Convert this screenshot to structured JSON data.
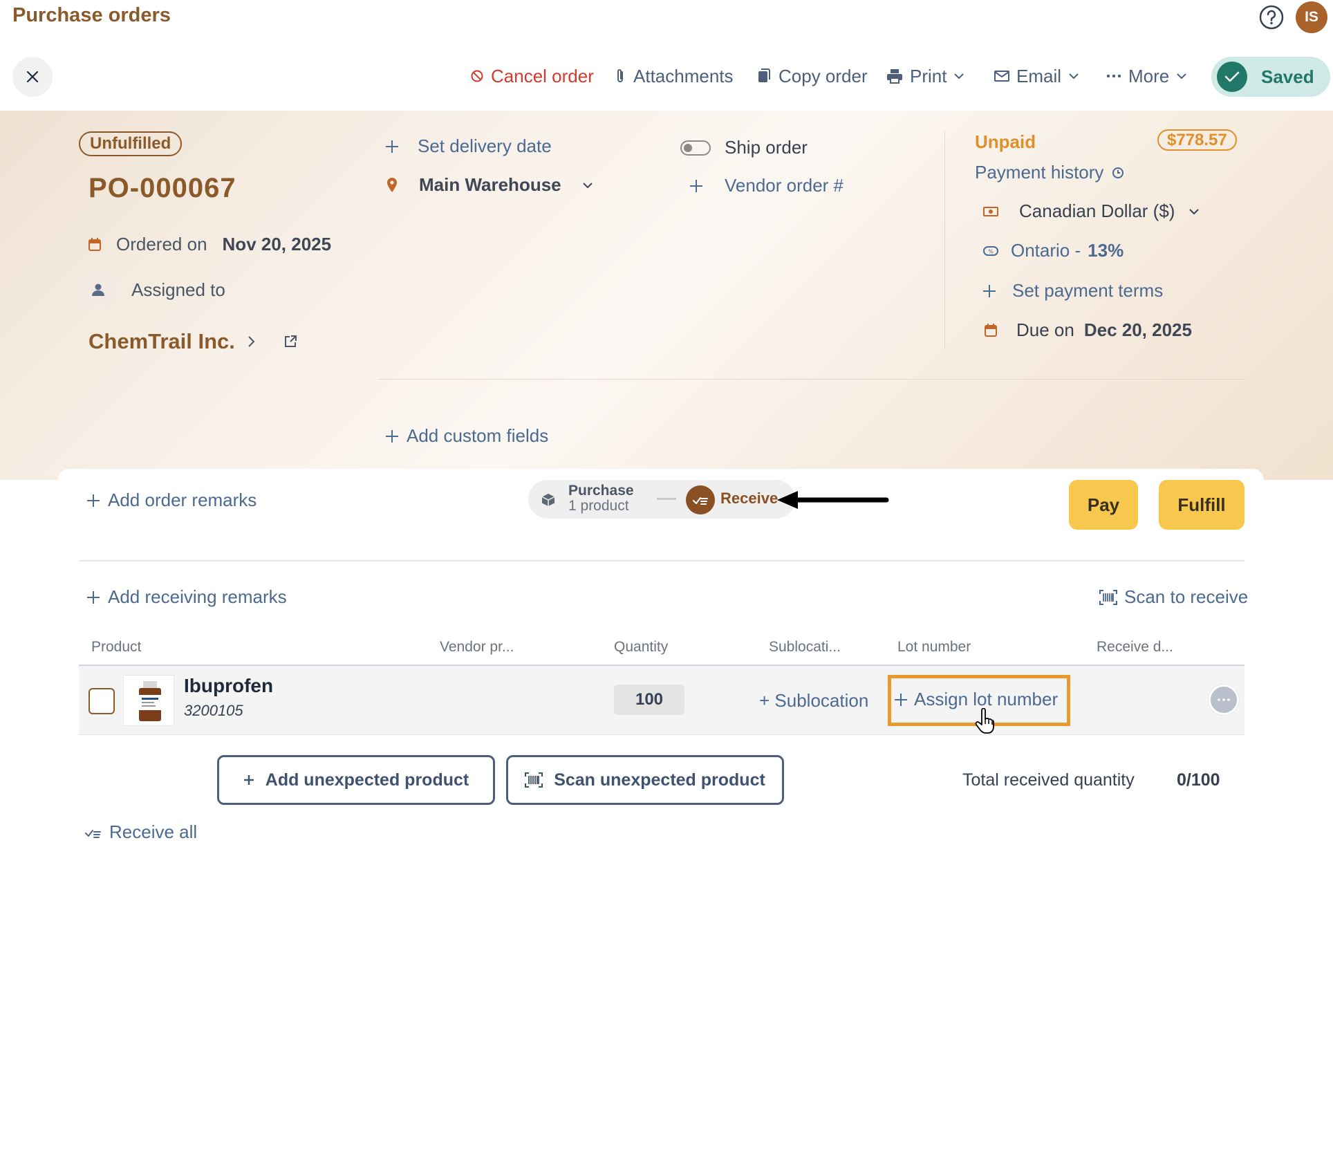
{
  "header": {
    "title": "Purchase orders",
    "avatar_initials": "IS"
  },
  "toolbar": {
    "cancel_order": "Cancel order",
    "attachments": "Attachments",
    "copy_order": "Copy order",
    "print": "Print",
    "email": "Email",
    "more": "More",
    "saved": "Saved"
  },
  "order": {
    "status": "Unfulfilled",
    "number": "PO-000067",
    "ordered_on_label": "Ordered on",
    "ordered_on_value": "Nov 20, 2025",
    "assigned_to_label": "Assigned to",
    "vendor": "ChemTrail Inc.",
    "set_delivery_date": "Set delivery date",
    "warehouse": "Main Warehouse",
    "ship_order_label": "Ship order",
    "ship_order_enabled": false,
    "vendor_order_no": "Vendor order #",
    "add_custom_fields": "Add custom fields"
  },
  "payment": {
    "status": "Unpaid",
    "amount": "$778.57",
    "payment_history": "Payment history",
    "currency": "Canadian Dollar ($)",
    "tax_region": "Ontario -",
    "tax_rate": "13%",
    "set_payment_terms": "Set payment terms",
    "due_on_label": "Due on",
    "due_on_value": "Dec 20, 2025"
  },
  "workflow": {
    "add_order_remarks": "Add order remarks",
    "purchase_label": "Purchase",
    "purchase_sub": "1 product",
    "receive_label": "Receive",
    "pay_button": "Pay",
    "fulfill_button": "Fulfill"
  },
  "receiving": {
    "add_receiving_remarks": "Add receiving remarks",
    "scan_to_receive": "Scan to receive",
    "columns": [
      "Product",
      "Vendor pr...",
      "Quantity",
      "Sublocati...",
      "Lot number",
      "Receive d..."
    ],
    "rows": [
      {
        "name": "Ibuprofen",
        "sku": "3200105",
        "quantity": "100",
        "sublocation": "+ Sublocation",
        "lot_number": "Assign lot number"
      }
    ],
    "add_unexpected_product": "Add unexpected product",
    "scan_unexpected_product": "Scan unexpected product",
    "total_received_label": "Total received quantity",
    "total_received_value": "0/100",
    "receive_all": "Receive all"
  },
  "colors": {
    "brand_brown": "#8a5a2b",
    "link_blue": "#4b6a91",
    "danger": "#d6382d",
    "warning_orange": "#e0902b",
    "primary_yellow": "#f7c84d",
    "saved_green": "#217868"
  }
}
